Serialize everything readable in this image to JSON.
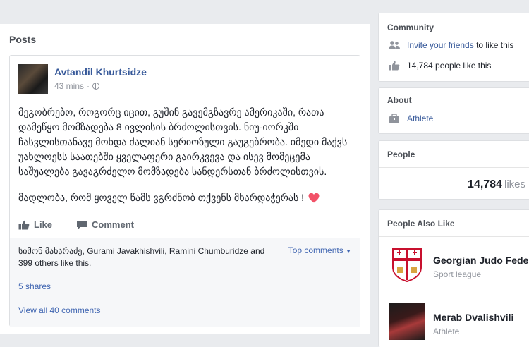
{
  "posts_section": {
    "title": "Posts"
  },
  "post": {
    "author": "Avtandil Khurtsidze",
    "time": "43 mins",
    "separator": "·",
    "text": "მეგობრებო, როგორც იცით, გუშინ გავემგზავრე ამერიკაში, რათა დამეწყო მომზადება 8 ივლისის ბრძოლისთვის. ნიუ-იორკში ჩასვლისთანავე მოხდა ძალიან სერიოზული გაუგებრობა. იმედი მაქვს უახლოესს საათებში ყველაფერი გაირკვევა და ისევ მომეცემა საშუალება გავაგრძელო მომზადება სანდერსთან ბრძოლისთვის.",
    "thanks": "მადლობა, რომ ყოველ წამს ვგრძნობ თქვენს მხარდაჭერას !",
    "like_label": "Like",
    "comment_label": "Comment",
    "likes_summary": "სიმონ მახარაძე, Gurami Javakhishvili, Ramini Chumburidze and 399 others like this.",
    "top_comments": "Top comments",
    "shares": "5 shares",
    "view_comments": "View all 40 comments"
  },
  "community": {
    "title": "Community",
    "invite_link": "Invite your friends",
    "invite_rest": "to like this",
    "likes_text": "14,784 people like this"
  },
  "about": {
    "title": "About",
    "category": "Athlete"
  },
  "people": {
    "title": "People",
    "count": "14,784",
    "likes_word": "likes"
  },
  "people_also_like": {
    "title": "People Also Like",
    "items": [
      {
        "name": "Georgian Judo Federa",
        "category": "Sport league"
      },
      {
        "name": "Merab Dvalishvili",
        "category": "Athlete"
      }
    ]
  },
  "colors": {
    "link": "#365899",
    "accent": "#4267b2",
    "heart": "#f25268",
    "background": "#e9ebee"
  }
}
